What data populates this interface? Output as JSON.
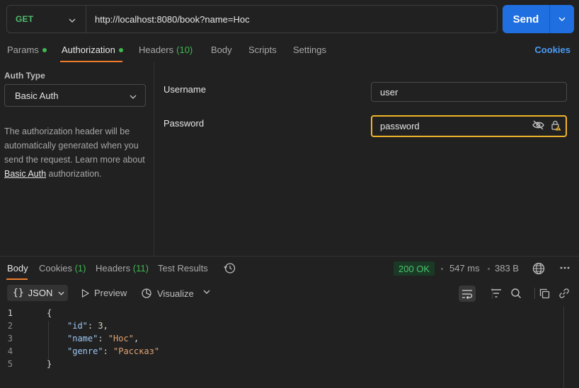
{
  "request": {
    "method": "GET",
    "url": "http://localhost:8080/book?name=Нос",
    "send_label": "Send"
  },
  "request_tabs": [
    {
      "label": "Params",
      "dot": true
    },
    {
      "label": "Authorization",
      "dot": true,
      "active": true
    },
    {
      "label": "Headers",
      "count": "(10)"
    },
    {
      "label": "Body"
    },
    {
      "label": "Scripts"
    },
    {
      "label": "Settings"
    }
  ],
  "cookies_link": "Cookies",
  "auth": {
    "type_label": "Auth Type",
    "type_value": "Basic Auth",
    "desc_before": "The authorization header will be automatically generated when you send the request. Learn more about ",
    "desc_link": "Basic Auth",
    "desc_after": " authorization.",
    "username_label": "Username",
    "username_value": "user",
    "password_label": "Password",
    "password_value": "password"
  },
  "response_tabs": [
    {
      "label": "Body",
      "active": true
    },
    {
      "label": "Cookies",
      "count": "(1)"
    },
    {
      "label": "Headers",
      "count": "(11)"
    },
    {
      "label": "Test Results"
    }
  ],
  "response_meta": {
    "status": "200 OK",
    "time": "547 ms",
    "size": "383 B"
  },
  "response_toolbar": {
    "format": "JSON",
    "preview": "Preview",
    "visualize": "Visualize"
  },
  "response_body": {
    "line_numbers": [
      "1",
      "2",
      "3",
      "4",
      "5"
    ],
    "open_brace": "{",
    "close_brace": "}",
    "fields": [
      {
        "key": "\"id\"",
        "value": "3",
        "sep": ","
      },
      {
        "key": "\"name\"",
        "value": "\"Нос\"",
        "sep": ","
      },
      {
        "key": "\"genre\"",
        "value": "\"Рассказ\"",
        "sep": ""
      }
    ]
  },
  "colors": {
    "accent_orange": "#f07c2a",
    "send_blue": "#1f6fe0",
    "success_green": "#3fb950",
    "focus_yellow": "#f0b429"
  }
}
